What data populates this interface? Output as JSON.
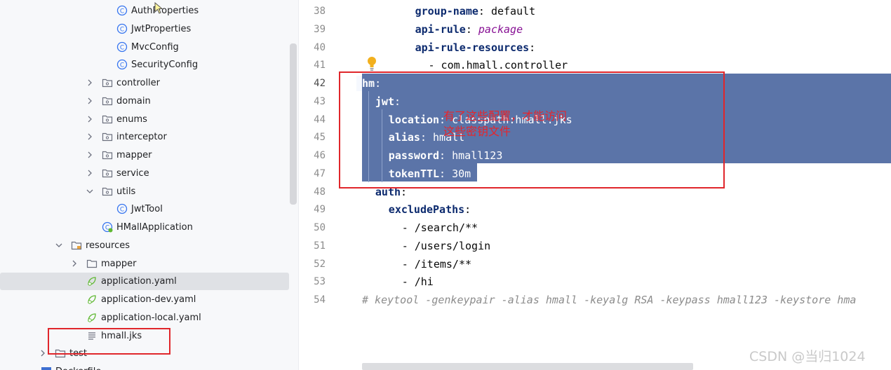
{
  "project_tree": {
    "items": [
      {
        "label": "AuthProperties",
        "kind": "class"
      },
      {
        "label": "JwtProperties",
        "kind": "class"
      },
      {
        "label": "MvcConfig",
        "kind": "class"
      },
      {
        "label": "SecurityConfig",
        "kind": "class"
      },
      {
        "label": "controller",
        "kind": "package"
      },
      {
        "label": "domain",
        "kind": "package"
      },
      {
        "label": "enums",
        "kind": "package"
      },
      {
        "label": "interceptor",
        "kind": "package"
      },
      {
        "label": "mapper",
        "kind": "package"
      },
      {
        "label": "service",
        "kind": "package"
      },
      {
        "label": "utils",
        "kind": "package"
      },
      {
        "label": "JwtTool",
        "kind": "class"
      },
      {
        "label": "HMallApplication",
        "kind": "spring-class"
      },
      {
        "label": "resources",
        "kind": "resources-folder"
      },
      {
        "label": "mapper",
        "kind": "folder"
      },
      {
        "label": "application.yaml",
        "kind": "yaml",
        "selected": true
      },
      {
        "label": "application-dev.yaml",
        "kind": "yaml"
      },
      {
        "label": "application-local.yaml",
        "kind": "yaml"
      },
      {
        "label": "hmall.jks",
        "kind": "text-file"
      },
      {
        "label": "test",
        "kind": "folder"
      },
      {
        "label": "Dockerfile",
        "kind": "docker"
      }
    ]
  },
  "editor": {
    "lines": [
      {
        "n": "38",
        "key": "group-name",
        "value": "default"
      },
      {
        "n": "39",
        "key": "api-rule",
        "value": "package"
      },
      {
        "n": "40",
        "key": "api-rule-resources",
        "value": ""
      },
      {
        "n": "41",
        "text": "- com.hmall.controller"
      },
      {
        "n": "42",
        "key": "hm",
        "value": ""
      },
      {
        "n": "43",
        "key": "jwt",
        "value": ""
      },
      {
        "n": "44",
        "key": "location",
        "value": "classpath:hmall.jks"
      },
      {
        "n": "45",
        "key": "alias",
        "value": "hmall"
      },
      {
        "n": "46",
        "key": "password",
        "value": "hmall123"
      },
      {
        "n": "47",
        "key": "tokenTTL",
        "value": "30m"
      },
      {
        "n": "48",
        "key": "auth",
        "value": ""
      },
      {
        "n": "49",
        "key": "excludePaths",
        "value": ""
      },
      {
        "n": "50",
        "text": "- /search/**"
      },
      {
        "n": "51",
        "text": "- /users/login"
      },
      {
        "n": "52",
        "text": "- /items/**"
      },
      {
        "n": "53",
        "text": "- /hi"
      },
      {
        "n": "54",
        "text": "# keytool -genkeypair -alias hmall -keyalg RSA -keypass hmall123 -keystore hma"
      }
    ]
  },
  "annotation": {
    "text": "有了这些配置，才能访问\n这些密钥文件",
    "color": "#e8242a"
  },
  "watermark": "CSDN @当归1024",
  "colors": {
    "selection": "#5b74a8",
    "annotation_box": "#e0262b",
    "yaml_key": "#0c2a6e"
  }
}
